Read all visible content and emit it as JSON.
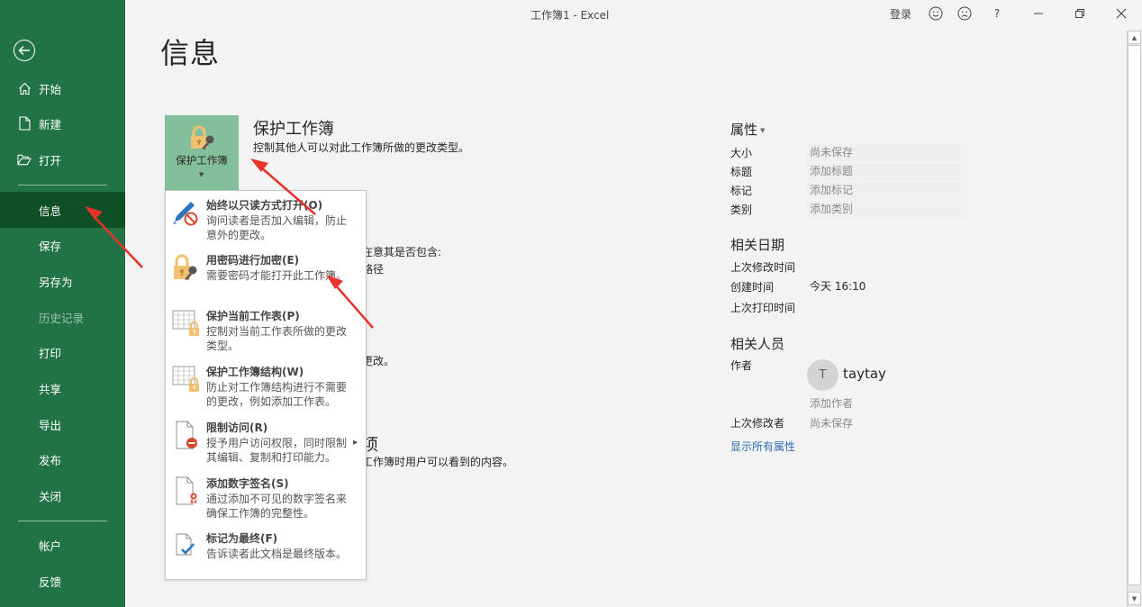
{
  "window": {
    "title": "工作簿1  -  Excel",
    "signin": "登录",
    "help": "?",
    "icons": [
      "smile-icon",
      "frown-icon",
      "help-icon",
      "minimize-icon",
      "restore-icon",
      "close-icon"
    ]
  },
  "sidebar": {
    "back_icon": "arrow-left-circle-icon",
    "items": [
      {
        "label": "开始",
        "icon": "home-icon"
      },
      {
        "label": "新建",
        "icon": "new-document-icon"
      },
      {
        "label": "打开",
        "icon": "folder-open-icon"
      },
      {
        "label": "信息",
        "active": true
      },
      {
        "label": "保存"
      },
      {
        "label": "另存为"
      },
      {
        "label": "历史记录",
        "disabled": true
      },
      {
        "label": "打印"
      },
      {
        "label": "共享"
      },
      {
        "label": "导出"
      },
      {
        "label": "发布"
      },
      {
        "label": "关闭"
      },
      {
        "label": "帐户"
      },
      {
        "label": "反馈"
      }
    ],
    "bg_color": "#217346",
    "active_color": "#0e4f26"
  },
  "main": {
    "title": "信息",
    "protect": {
      "button_label": "保护工作簿",
      "title": "保护工作簿",
      "description": "控制其他人可以对此工作簿所做的更改类型。"
    },
    "obscured_text": [
      "在意其是否包含:",
      "路径",
      "更改。",
      "项",
      "工作簿时用户可以看到的内容。"
    ]
  },
  "protect_menu": {
    "items": [
      {
        "title": "始终以只读方式打开(O)",
        "desc": "询问读者是否加入编辑，防止意外的更改。",
        "icon": "pencil-prohibited-icon"
      },
      {
        "title": "用密码进行加密(E)",
        "desc": "需要密码才能打开此工作簿。",
        "icon": "lock-key-icon"
      },
      {
        "title": "保护当前工作表(P)",
        "desc": "控制对当前工作表所做的更改类型。",
        "icon": "sheet-lock-icon"
      },
      {
        "title": "保护工作簿结构(W)",
        "desc": "防止对工作簿结构进行不需要的更改，例如添加工作表。",
        "icon": "workbook-lock-icon"
      },
      {
        "title": "限制访问(R)",
        "desc": "授予用户访问权限，同时限制其编辑、复制和打印能力。",
        "icon": "document-restricted-icon",
        "has_submenu": true
      },
      {
        "title": "添加数字签名(S)",
        "desc": "通过添加不可见的数字签名来确保工作簿的完整性。",
        "icon": "document-ribbon-icon"
      },
      {
        "title": "标记为最终(F)",
        "desc": "告诉读者此文档是最终版本。",
        "icon": "document-check-icon"
      }
    ]
  },
  "properties": {
    "heading": "属性",
    "rows": [
      {
        "label": "大小",
        "value": "尚未保存"
      },
      {
        "label": "标题",
        "value": "添加标题"
      },
      {
        "label": "标记",
        "value": "添加标记"
      },
      {
        "label": "类别",
        "value": "添加类别"
      }
    ],
    "dates_heading": "相关日期",
    "dates": [
      {
        "label": "上次修改时间",
        "value": ""
      },
      {
        "label": "创建时间",
        "value": "今天 16:10"
      },
      {
        "label": "上次打印时间",
        "value": ""
      }
    ],
    "people_heading": "相关人员",
    "author_label": "作者",
    "author_initial": "T",
    "author_name": "taytay",
    "add_author": "添加作者",
    "last_modified_by_label": "上次修改者",
    "last_modified_by_value": "尚未保存",
    "show_all": "显示所有属性"
  },
  "annotation_color": "#e8322c"
}
